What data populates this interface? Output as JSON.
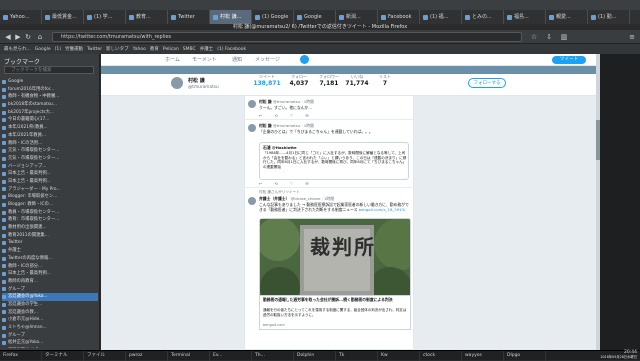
{
  "window": {
    "title": "村松 謙(@muramatsu2/ 6) /Twitterでの返信付きツイート - Mozilla Firefox"
  },
  "tabs": [
    {
      "label": "Yahoo..."
    },
    {
      "label": "最低賃金..."
    },
    {
      "label": "(1) 学..."
    },
    {
      "label": "教育..."
    },
    {
      "label": "Twitter"
    },
    {
      "label": "村松 謙..."
    },
    {
      "label": "(1) Google"
    },
    {
      "label": "Google"
    },
    {
      "label": "新潟..."
    },
    {
      "label": "Facebook"
    },
    {
      "label": "(1) 福..."
    },
    {
      "label": "とみの..."
    },
    {
      "label": "福島..."
    },
    {
      "label": "親愛..."
    },
    {
      "label": "(1) 勤..."
    }
  ],
  "toolbar": {
    "url": "https://twitter.com/tmuramatsu/with_replies"
  },
  "bookmarks_bar": [
    "最も見られ...",
    "Google",
    "(1)",
    "労働運動",
    "Twitter",
    "新しいタブ",
    "Yahoo",
    "教育",
    "Pelican",
    "SMBC",
    "弁護士",
    "(1) Facebook"
  ],
  "sidebar": {
    "title": "ブックマーク",
    "search_placeholder": "ブックマークを検索",
    "items": [
      {
        "label": "Google",
        "selected": false
      },
      {
        "label": "forum2016年用のfor...",
        "selected": false
      },
      {
        "label": "教師・有機食物・中教審...",
        "selected": false
      },
      {
        "label": "bk2018年のstamatsu...",
        "selected": false
      },
      {
        "label": "bk2017年projects大...",
        "selected": false
      },
      {
        "label": "今日の書籍関心(17...",
        "selected": false
      },
      {
        "label": "本年/2021県(教員...",
        "selected": false
      },
      {
        "label": "本年/2021年教員...",
        "selected": false
      },
      {
        "label": "教師・ICの活用...",
        "selected": false
      },
      {
        "label": "元気・市場取扱センター...",
        "selected": false
      },
      {
        "label": "元気・市場取扱センター...",
        "selected": false
      },
      {
        "label": "バージョンアップ...",
        "selected": false
      },
      {
        "label": "日本上告・最高判例...",
        "selected": false
      },
      {
        "label": "日本上告・最高判例...",
        "selected": false
      },
      {
        "label": "アラジャーダー - My Pro...",
        "selected": false
      },
      {
        "label": "Blogger: 市場取扱セン...",
        "selected": false
      },
      {
        "label": "Blogger: 教師・ICの...",
        "selected": false
      },
      {
        "label": "教員・市場取扱センター...",
        "selected": false
      },
      {
        "label": "教育：市場取扱センター...",
        "selected": false
      },
      {
        "label": "教材用の出張関連...",
        "selected": false
      },
      {
        "label": "教育2011の関連集...",
        "selected": false
      },
      {
        "label": "Twitter",
        "selected": false
      },
      {
        "label": "弁護士",
        "selected": false
      },
      {
        "label": "Twitterの再度な情報...",
        "selected": false
      },
      {
        "label": "教師・ICの部分...",
        "selected": false
      },
      {
        "label": "日本上告・最高判例...",
        "selected": false
      },
      {
        "label": "教師の再教育...",
        "selected": false
      },
      {
        "label": "グループ",
        "selected": false
      },
      {
        "label": "宮廷議会の@Yoka...",
        "selected": true
      },
      {
        "label": "宮廷議会の学生...",
        "selected": false
      },
      {
        "label": "宮廷議会の教...",
        "selected": false
      },
      {
        "label": "小倉市元@Hide...",
        "selected": false
      },
      {
        "label": "ミトちゃ@Imnsn...",
        "selected": false
      },
      {
        "label": "グループ",
        "selected": false
      },
      {
        "label": "松井正元@Yoko...",
        "selected": false
      },
      {
        "label": "渡辺洋平 Yuji Ox...",
        "selected": false
      },
      {
        "label": "寄稿者の Tori Ta...",
        "selected": false
      },
      {
        "label": "教育取引@Taxa...",
        "selected": false
      }
    ]
  },
  "twitter_nav": {
    "home": "ホーム",
    "moments": "モーメント",
    "notifications": "通知",
    "messages": "メッセージ",
    "tweet_button": "ツイート"
  },
  "profile": {
    "name": "村松 謙",
    "handle": "@tmuramatsu",
    "stats": [
      {
        "label": "ツイート",
        "value": "138,871",
        "active": true
      },
      {
        "label": "フォロー",
        "value": "4,037",
        "active": false
      },
      {
        "label": "フォロワー",
        "value": "7,181",
        "active": false
      },
      {
        "label": "いいね",
        "value": "71,774",
        "active": false
      },
      {
        "label": "リスト",
        "value": "7",
        "active": false
      }
    ],
    "follow_button": "フォローする"
  },
  "tweets": [
    {
      "name": "村松 謙",
      "handle": "@tmuramatsu · 1時間",
      "text": "うーん。すごい。他になんか...",
      "actions": [
        "↩",
        "⟲",
        "♡",
        "✉"
      ]
    },
    {
      "name": "村松 謙",
      "handle": "@tmuramatsu · 1時間",
      "text": "「企業のひとは」で「ちびまるこちゃん」を連載していれば。。。",
      "quote_name": "石浦 @Hashiotte",
      "quote_text": "「1988年......4月1日に同じ「ゴミ」に入社するが、数時間後に解雇となる等して、上司から「会社を替わる」と言われた「ふぃ」と謂いうあり、この日は「連載の決まり」に移行した。同年6月1日に入社するが、数時間後に再び、同年6月にて「ちびまるこちゃん」の連載開始",
      "actions": [
        "↩",
        "⟲",
        "♡",
        "✉"
      ]
    },
    {
      "retweet_note": "村松 謙さんがリツイート",
      "name": "弁護士（弁護士）",
      "handle": "@tinase_chiane · 1時間",
      "text": "こんな記事もありました → 勤務医医療訴訟で起業家医者の新しい働き方に、勤め務ができる「勤務医者」に判決下された判断をする制度ニュース",
      "link": "bengo4.com/c_18_3913/",
      "card_title": "勤務医の通報した過労事を取った会社が勝訴...続く勤務医の制度による判決",
      "card_text": "通報を行の者たちにとってこれを運用する制度に関する、組合団体の判決が出され、判定は過労の取扱い方法を示すように。",
      "card_domain": "bengo4.com",
      "actions": [
        "↩",
        "⟲",
        "♡",
        "✉"
      ]
    }
  ],
  "photo": {
    "sign_text": "裁判所"
  },
  "taskbar": {
    "items": [
      "Firefox",
      "ターミナル",
      "ファイル",
      "pwroz",
      "Terminal",
      "Ev...",
      "Th...",
      "Dolphin",
      "Tk",
      "Kw",
      "ctock",
      "wayyos",
      "Dlpgo"
    ],
    "time": "20:44",
    "date": "2018年09月28日水曜日"
  },
  "colors": {
    "twitter_blue": "#1da1f2",
    "chrome_dark": "#2f3133",
    "sidebar_bg": "#3a3d40",
    "selection": "#3e77b6"
  }
}
